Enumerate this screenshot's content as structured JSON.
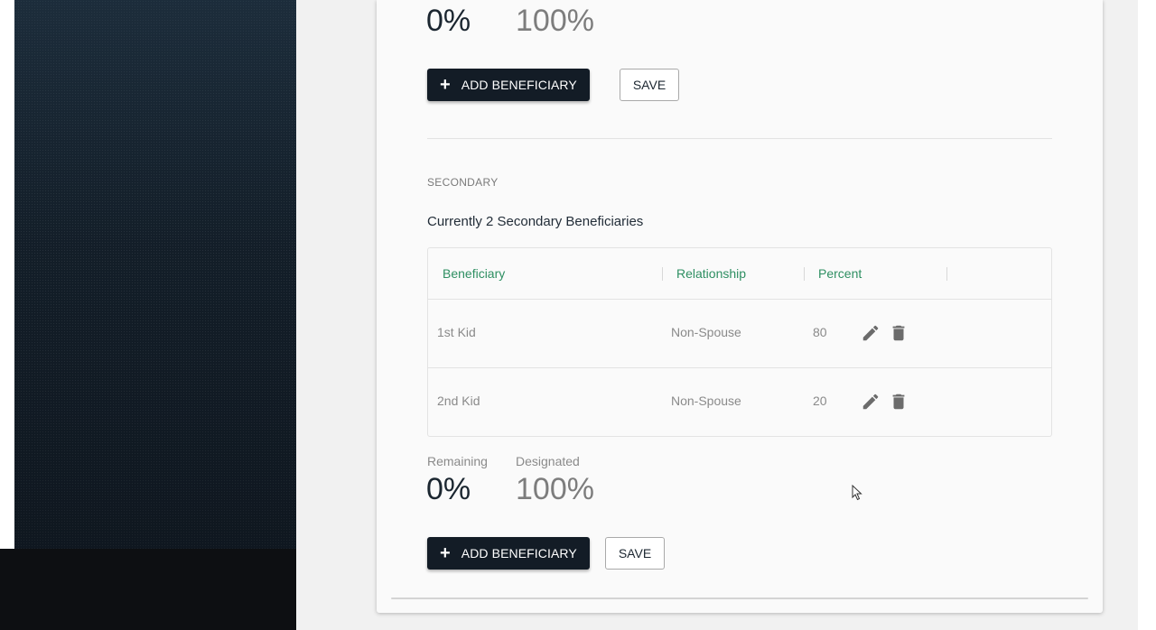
{
  "top_summary": {
    "remaining_value": "0%",
    "designated_value": "100%",
    "add_label": "ADD BENEFICIARY",
    "save_label": "SAVE"
  },
  "secondary": {
    "section_label": "SECONDARY",
    "count_title": "Currently 2 Secondary Beneficiaries",
    "columns": [
      "Beneficiary",
      "Relationship",
      "Percent"
    ],
    "rows": [
      {
        "beneficiary": "1st Kid",
        "relationship": "Non-Spouse",
        "percent": "80"
      },
      {
        "beneficiary": "2nd Kid",
        "relationship": "Non-Spouse",
        "percent": "20"
      }
    ],
    "remaining_label": "Remaining",
    "remaining_value": "0%",
    "designated_label": "Designated",
    "designated_value": "100%",
    "add_label": "ADD BENEFICIARY",
    "save_label": "SAVE"
  },
  "icons": {
    "plus": "plus-icon",
    "edit": "pencil-icon",
    "delete": "trash-icon",
    "cursor": "mouse-pointer-icon"
  },
  "colors": {
    "primary_button": "#131c26",
    "header_text": "#2e8f62",
    "dark_panel": "#14202b"
  }
}
